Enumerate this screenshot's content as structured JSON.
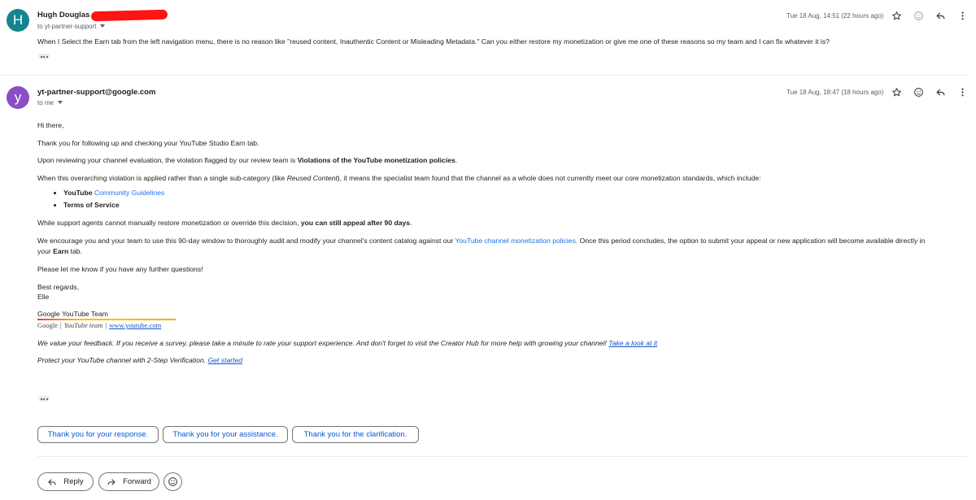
{
  "message1": {
    "avatar_letter": "H",
    "avatar_color": "#12858f",
    "sender": "Hugh Douglas",
    "to_line": "to yt-partner-support",
    "date": "Tue 18 Aug, 14:51 (22 hours ago)",
    "body": "When I Select the Earn tab from the left navigation menu, there is no reason like \"reused content, Inauthentic Content or Misleading Metadata.\" Can you either restore my monetization or give me one of these reasons so my team and I can fix whatever it is?"
  },
  "message2": {
    "avatar_letter": "y",
    "avatar_color": "#8a4fc6",
    "sender": "yt-partner-support@google.com",
    "to_line": "to me",
    "date": "Tue 18 Aug, 18:47 (18 hours ago)",
    "greeting": "Hi there,",
    "p1": "Thank you for following up and checking your YouTube Studio Earn tab.",
    "p2_pre": "Upon reviewing your channel evaluation, the violation flagged by our review team is ",
    "p2_bold": "Violations of the YouTube monetization policies",
    "p2_post": ".",
    "p3_pre": "When this overarching violation is applied rather than a single sub-category (like ",
    "p3_italic": "Reused Content",
    "p3_post": "), it means the specialist team found that the channel as a whole does not currently meet our core monetization standards, which include:",
    "bullets": {
      "b1_bold": "YouTube",
      "b1_link": "Community Guidelines",
      "b2_bold": "Terms of Service"
    },
    "p4_pre": "While support agents cannot manually restore monetization or override this decision, ",
    "p4_bold": "you can still appeal after 90 days",
    "p4_post": ".",
    "p5_pre": "We encourage you and your team to use this 90-day window to thoroughly audit and modify your channel's content catalog against our ",
    "p5_link": "YouTube channel monetization policies.",
    "p5_post": " Once this period concludes, the option to submit your appeal or new application will become available directly in",
    "p5_line2_pre": "your ",
    "p5_line2_bold": "Earn",
    "p5_line2_post": " tab.",
    "p6": "Please let me know if you have any further questions!",
    "closing1": "Best regards,",
    "closing2": "Elle",
    "sig_name": "Google YouTube Team",
    "sig_google": "Google",
    "sig_divider": "|",
    "sig_team": "YouTube team",
    "sig_url": "www.youtube.com",
    "feedback_text": "We value your feedback. If you receive a survey, please take a minute to rate your support experience. And don't forget to visit the Creator Hub for more help with growing your channel!",
    "feedback_link": "Take a look at it",
    "protect_text": "Protect your YouTube channel with 2-Step Verification.",
    "protect_link": "Get started"
  },
  "smart_replies": [
    "Thank you for your response.",
    "Thank you for your assistance.",
    "Thank you for the clarification."
  ],
  "actions": {
    "reply": "Reply",
    "forward": "Forward"
  },
  "icons": [
    "star-icon",
    "emoji-icon",
    "reply-icon",
    "more-vert-icon",
    "forward-icon"
  ]
}
